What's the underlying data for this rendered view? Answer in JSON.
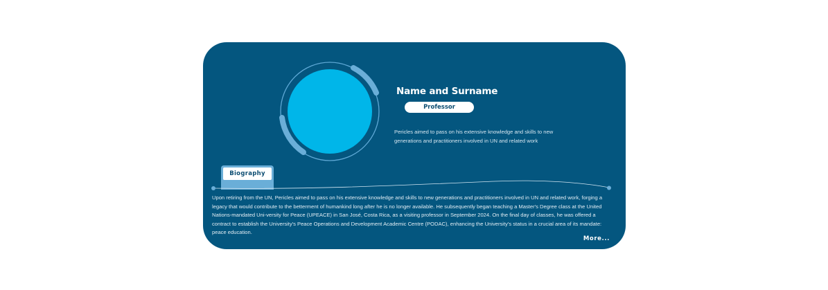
{
  "profile": {
    "name": "Name and Surname",
    "role": "Professor",
    "summary": "Pericles aimed to pass on his extensive knowledge and skills to new generations and practitioners involved in UN and related work"
  },
  "biography": {
    "tab_label": "Biography",
    "text": "Upon retiring from the UN, Pericles aimed to pass on his extensive knowledge and skills to new generations and practitioners involved in UN and related work, forging a legacy that would contribute to the betterment of humankind long after he is no longer available. He subsequently began teaching a Master's Degree class at the United Nations-mandated Uni-versity for Peace (UPEACE) in San José, Costa Rica, as a visiting professor in September 2024. On the final day of classes, he was offered a contract to establish the University's Peace Operations and Development Academic Centre (PODAC), enhancing the University's status in a crucial area of its mandate: peace education.",
    "more_label": "More..."
  },
  "colors": {
    "card_background": "#04567f",
    "avatar_fill": "#00b6e9",
    "accent_arc": "#6aaed8",
    "pill_background": "#ffffff",
    "page_background": "#ffffff"
  },
  "icons": {
    "avatar": "avatar-placeholder-circle"
  }
}
